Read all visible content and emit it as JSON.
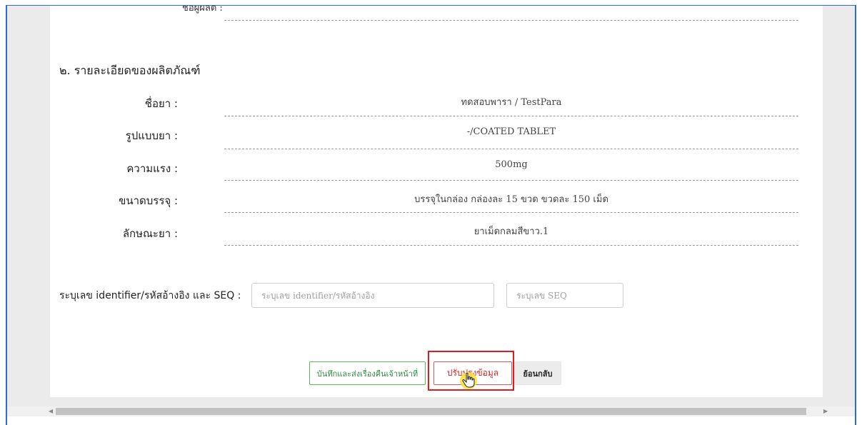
{
  "partial_label": "ชื่อผู้ผลิต :",
  "section": {
    "title": "๒. รายละเอียดของผลิตภัณฑ์",
    "rows": [
      {
        "label": "ชื่อยา :",
        "value": "ทดสอบพารา / TestPara"
      },
      {
        "label": "รูปแบบยา :",
        "value": "-/COATED TABLET"
      },
      {
        "label": "ความแรง :",
        "value": "500mg"
      },
      {
        "label": "ขนาดบรรจุ :",
        "value": "บรรจุในกล่อง กล่องละ 15 ขวด ขวดละ 150 เม็ด"
      },
      {
        "label": "ลักษณะยา :",
        "value": "ยาเม็ดกลมสีขาว.1"
      }
    ]
  },
  "identifier": {
    "label": "ระบุเลข identifier/รหัสอ้างอิง และ SEQ :",
    "identifier_placeholder": "ระบุเลข identifier/รหัสอ้างอิง",
    "seq_placeholder": "ระบุเลข SEQ"
  },
  "buttons": {
    "save_send": "บันทึกและส่งเรื่องคืนเจ้าหน้าที่",
    "update": "ปรับปรุงข้อมูล",
    "back": "ย้อนกลับ"
  },
  "colors": {
    "frame_border": "#2b6cd4",
    "highlight": "#e01b1b",
    "cursor_halo": "#ffe132"
  }
}
